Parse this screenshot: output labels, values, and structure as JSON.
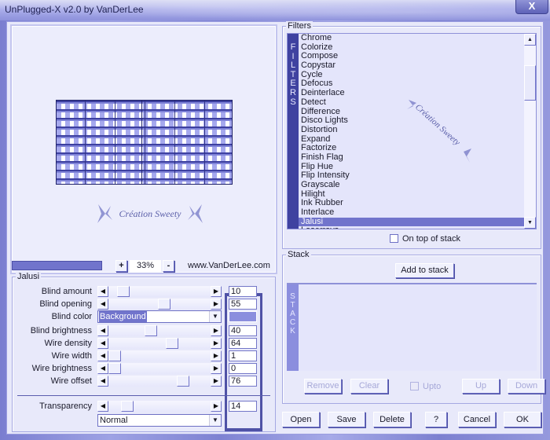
{
  "window": {
    "title": "UnPlugged-X v2.0 by VanDerLee",
    "close_glyph": "X"
  },
  "preview": {
    "watermark": "Création Sweety",
    "zoom_in_label": "+",
    "zoom_out_label": "-",
    "zoom_level": "33%",
    "website": "www.VanDerLee.com"
  },
  "jalusi": {
    "group_label": "Jalusi",
    "params": [
      {
        "label": "Blind amount",
        "value": "10",
        "position": 0.1
      },
      {
        "label": "Blind opening",
        "value": "55",
        "position": 0.55
      },
      {
        "label": "Blind brightness",
        "value": "40",
        "position": 0.4
      },
      {
        "label": "Wire density",
        "value": "64",
        "position": 0.64
      },
      {
        "label": "Wire width",
        "value": "1",
        "position": 0.0
      },
      {
        "label": "Wire brightness",
        "value": "0",
        "position": 0.0
      },
      {
        "label": "Wire offset",
        "value": "76",
        "position": 0.76
      }
    ],
    "blind_color": {
      "label": "Blind color",
      "selected": "Background",
      "swatch": "#8b8ede"
    },
    "transparency": {
      "label": "Transparency",
      "value": "14",
      "position": 0.14
    },
    "blend_mode": "Normal"
  },
  "filters": {
    "group_label": "Filters",
    "side_label": [
      "F",
      "I",
      "L",
      "T",
      "E",
      "R",
      "S"
    ],
    "items": [
      "Chrome",
      "Colorize",
      "Compose",
      "Copystar",
      "Cycle",
      "Defocus",
      "Deinterlace",
      "Detect",
      "Difference",
      "Disco Lights",
      "Distortion",
      "Expand",
      "Factorize",
      "Finish Flag",
      "Flip Hue",
      "Flip Intensity",
      "Grayscale",
      "Hilight",
      "Ink Rubber",
      "Interlace",
      "Jalusi",
      "Laserrays"
    ],
    "selected": "Jalusi",
    "on_top_label": "On top of stack",
    "watermark": "Création Sweety"
  },
  "stack": {
    "group_label": "Stack",
    "add_label": "Add to stack",
    "side_label": [
      "S",
      "T",
      "A",
      "C",
      "K"
    ],
    "remove_label": "Remove",
    "clear_label": "Clear",
    "upto_label": "Upto",
    "up_label": "Up",
    "down_label": "Down"
  },
  "footer": {
    "open_label": "Open",
    "save_label": "Save",
    "delete_label": "Delete",
    "help_label": "?",
    "cancel_label": "Cancel",
    "ok_label": "OK"
  }
}
